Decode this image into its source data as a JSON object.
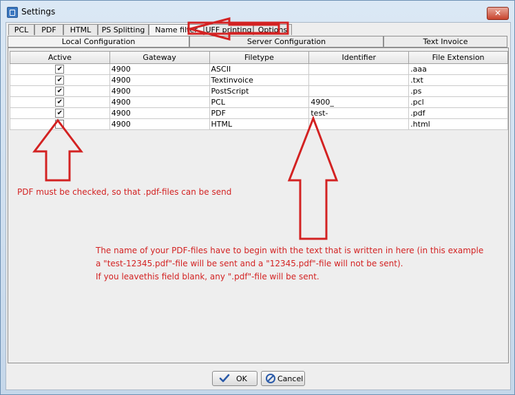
{
  "window": {
    "title": "Settings",
    "close_label": "✕"
  },
  "tabs_top": [
    {
      "label": "PCL"
    },
    {
      "label": "PDF"
    },
    {
      "label": "HTML"
    },
    {
      "label": "PS Splitting"
    },
    {
      "label": "Name filter"
    },
    {
      "label": "UFF printing"
    },
    {
      "label": "Options"
    }
  ],
  "tabs_second": [
    {
      "label": "Local Configuration"
    },
    {
      "label": "Server Configuration"
    },
    {
      "label": "Text Invoice"
    }
  ],
  "table": {
    "headers": [
      "Active",
      "Gateway",
      "Filetype",
      "Identifier",
      "File Extension"
    ],
    "rows": [
      {
        "active": "✔",
        "gateway": "4900",
        "filetype": "ASCII",
        "identifier": "",
        "ext": ".aaa"
      },
      {
        "active": "✔",
        "gateway": "4900",
        "filetype": "Textinvoice",
        "identifier": "",
        "ext": ".txt"
      },
      {
        "active": "✔",
        "gateway": "4900",
        "filetype": "PostScript",
        "identifier": "",
        "ext": ".ps"
      },
      {
        "active": "✔",
        "gateway": "4900",
        "filetype": "PCL",
        "identifier": "4900_",
        "ext": ".pcl"
      },
      {
        "active": "✔",
        "gateway": "4900",
        "filetype": "PDF",
        "identifier": "test-",
        "ext": ".pdf"
      },
      {
        "active": "",
        "gateway": "4900",
        "filetype": "HTML",
        "identifier": "",
        "ext": ".html"
      }
    ]
  },
  "annotations": {
    "pdf_checked": "PDF must be checked, so that .pdf-files can be send",
    "identifier_line1": "The name of your PDF-files have to begin with the text that is written in here (in this example",
    "identifier_line2": "a \"test-12345.pdf\"-file will be sent and a \"12345.pdf\"-file will not be sent).",
    "identifier_line3": "If you leavethis field blank, any \".pdf\"-file will be sent."
  },
  "buttons": {
    "ok": "OK",
    "cancel": "Cancel"
  },
  "icons": {
    "ok": "checkmark-icon",
    "cancel": "cancel-icon"
  },
  "colors": {
    "annotation": "#d32222",
    "title_bar": "#c5d7ea"
  }
}
